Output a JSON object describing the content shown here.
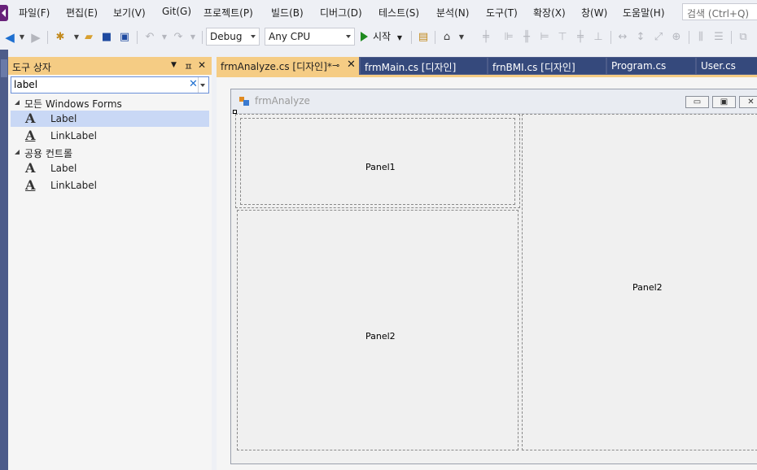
{
  "menu": {
    "items": [
      "파일(F)",
      "편집(E)",
      "보기(V)",
      "Git(G)",
      "프로젝트(P)",
      "빌드(B)",
      "디버그(D)",
      "테스트(S)",
      "분석(N)",
      "도구(T)",
      "확장(X)",
      "창(W)",
      "도움말(H)"
    ],
    "search_placeholder": "검색 (Ctrl+Q)"
  },
  "toolbar": {
    "configuration": "Debug",
    "platform": "Any CPU",
    "start_label": "시작",
    "icons": [
      "back-icon",
      "forward-icon",
      "new-project-icon",
      "open-icon",
      "save-icon",
      "save-all-icon",
      "undo-icon",
      "redo-icon",
      "play-icon",
      "find-icon",
      "home-icon",
      "align-icons"
    ]
  },
  "toolbox": {
    "title": "도구 상자",
    "pin_glyph": "ㅍ",
    "close_glyph": "✕",
    "search_value": "label",
    "groups": [
      {
        "label": "모든 Windows Forms",
        "items": [
          {
            "label": "Label",
            "selected": true
          },
          {
            "label": "LinkLabel",
            "selected": false
          }
        ]
      },
      {
        "label": "공용 컨트롤",
        "items": [
          {
            "label": "Label",
            "selected": false
          },
          {
            "label": "LinkLabel",
            "selected": false
          }
        ]
      }
    ]
  },
  "editor": {
    "tabs": [
      {
        "label": "frmAnalyze.cs [디자인]*",
        "active": true
      },
      {
        "label": "frmMain.cs [디자인]",
        "active": false
      },
      {
        "label": "frnBMI.cs [디자인]",
        "active": false
      },
      {
        "label": "Program.cs",
        "active": false
      },
      {
        "label": "User.cs",
        "active": false
      }
    ],
    "form": {
      "title": "frmAnalyze",
      "panels": [
        "Panel1",
        "Panel2",
        "Panel2"
      ]
    }
  },
  "colors": {
    "accent_tab": "#f5cc84",
    "editor_frame": "#4d5c8a",
    "selected_item": "#c9d8f5"
  }
}
